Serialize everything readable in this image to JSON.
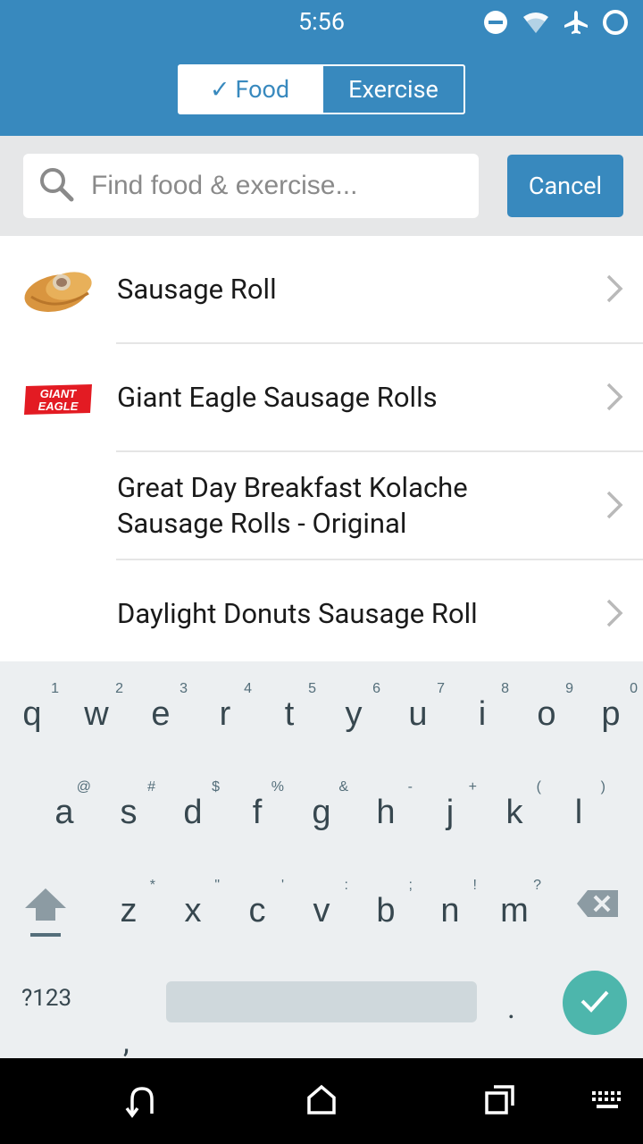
{
  "status_bar": {
    "time": "5:56"
  },
  "toggle": {
    "food_label": "Food",
    "check": "✓",
    "exercise_label": "Exercise"
  },
  "search": {
    "placeholder": "Find food & exercise...",
    "cancel_label": "Cancel"
  },
  "results": [
    {
      "label": "Sausage Roll",
      "thumb": "sausage-roll-photo"
    },
    {
      "label": "Giant Eagle Sausage Rolls",
      "thumb": "giant-eagle-logo",
      "logo_text_1": "GIANT",
      "logo_text_2": "EAGLE"
    },
    {
      "label_line1": "Great Day Breakfast Kolache",
      "label_line2": "Sausage Rolls - Original"
    },
    {
      "label": "Daylight Donuts Sausage Roll"
    }
  ],
  "keyboard": {
    "row1": [
      {
        "ch": "q",
        "hint": "1"
      },
      {
        "ch": "w",
        "hint": "2"
      },
      {
        "ch": "e",
        "hint": "3"
      },
      {
        "ch": "r",
        "hint": "4"
      },
      {
        "ch": "t",
        "hint": "5"
      },
      {
        "ch": "y",
        "hint": "6"
      },
      {
        "ch": "u",
        "hint": "7"
      },
      {
        "ch": "i",
        "hint": "8"
      },
      {
        "ch": "o",
        "hint": "9"
      },
      {
        "ch": "p",
        "hint": "0"
      }
    ],
    "row2": [
      {
        "ch": "a",
        "hint": "@"
      },
      {
        "ch": "s",
        "hint": "#"
      },
      {
        "ch": "d",
        "hint": "$"
      },
      {
        "ch": "f",
        "hint": "%"
      },
      {
        "ch": "g",
        "hint": "&"
      },
      {
        "ch": "h",
        "hint": "-"
      },
      {
        "ch": "j",
        "hint": "+"
      },
      {
        "ch": "k",
        "hint": "("
      },
      {
        "ch": "l",
        "hint": ")"
      }
    ],
    "row3": [
      {
        "ch": "z",
        "hint": "*"
      },
      {
        "ch": "x",
        "hint": "\""
      },
      {
        "ch": "c",
        "hint": "'"
      },
      {
        "ch": "v",
        "hint": ":"
      },
      {
        "ch": "b",
        "hint": ";"
      },
      {
        "ch": "n",
        "hint": "!"
      },
      {
        "ch": "m",
        "hint": "?"
      }
    ],
    "symbols_label": "?123",
    "comma": ",",
    "period": "."
  },
  "colors": {
    "header": "#3889be",
    "keyboard_bg": "#eceff1",
    "enter": "#4db6ac"
  }
}
